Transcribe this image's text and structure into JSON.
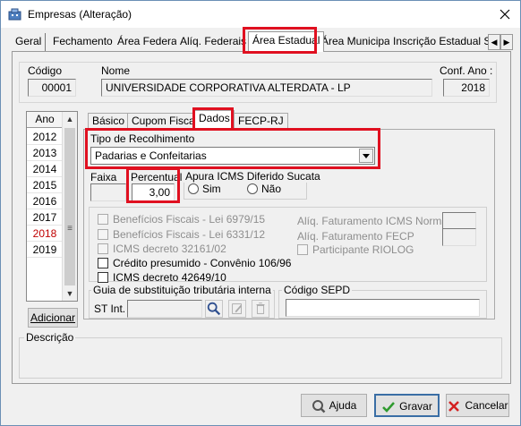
{
  "window": {
    "title": "Empresas (Alteração)"
  },
  "tabs": [
    {
      "label": "Geral"
    },
    {
      "label": "Fechamento"
    },
    {
      "label": "Área Federal"
    },
    {
      "label": "Alíq. Federais"
    },
    {
      "label": "Área Estadual"
    },
    {
      "label": "Área Municipal"
    },
    {
      "label": "Inscrição Estadual S"
    }
  ],
  "header": {
    "codigo_label": "Código",
    "codigo_value": "00001",
    "nome_label": "Nome",
    "nome_value": "UNIVERSIDADE CORPORATIVA ALTERDATA - LP",
    "conf_ano_label": "Conf. Ano :",
    "conf_ano_value": "2018"
  },
  "years": {
    "header": "Ano",
    "items": [
      "2012",
      "2013",
      "2014",
      "2015",
      "2016",
      "2017",
      "2018",
      "2019"
    ],
    "selected": "2018",
    "add_button": "Adicionar"
  },
  "inner_tabs": [
    {
      "label": "Básico"
    },
    {
      "label": "Cupom Fiscal"
    },
    {
      "label": "Dados"
    },
    {
      "label": "FECP-RJ"
    }
  ],
  "dados": {
    "tipo_recolhimento_label": "Tipo de Recolhimento",
    "tipo_recolhimento_value": "Padarias e Confeitarias",
    "faixa_label": "Faixa",
    "percentual_label": "Percentual",
    "percentual_value": "3,00",
    "apura_label": "Apura ICMS Diferido Sucata",
    "sim_label": "Sim",
    "nao_label": "Não"
  },
  "checks": [
    {
      "label": "Benefícios Fiscais - Lei 6979/15",
      "enabled": false
    },
    {
      "label": "Benefícios Fiscais - Lei 6331/12",
      "enabled": false
    },
    {
      "label": "ICMS decreto 32161/02",
      "enabled": false
    },
    {
      "label": "Crédito presumido - Convênio 106/96",
      "enabled": true
    },
    {
      "label": "ICMS decreto 42649/10",
      "enabled": true
    }
  ],
  "right_fields": {
    "aliq_icms_normal": "Alíq. Faturamento ICMS Normal",
    "aliq_fecp": "Alíq. Faturamento FECP",
    "participante_riolog": "Participante RIOLOG"
  },
  "guia": {
    "title": "Guia de substituição tributária interna",
    "st_label": "ST Int."
  },
  "sepd": {
    "title": "Código SEPD"
  },
  "descricao": {
    "title": "Descrição"
  },
  "footer": {
    "ajuda": "Ajuda",
    "gravar": "Gravar",
    "cancelar": "Cancelar"
  },
  "colors": {
    "highlight": "#e01020",
    "selected_year": "#c00000"
  },
  "icons": [
    "app-icon",
    "close-icon",
    "search-icon",
    "edit-icon",
    "delete-icon",
    "help-icon",
    "check-icon",
    "cancel-icon"
  ]
}
